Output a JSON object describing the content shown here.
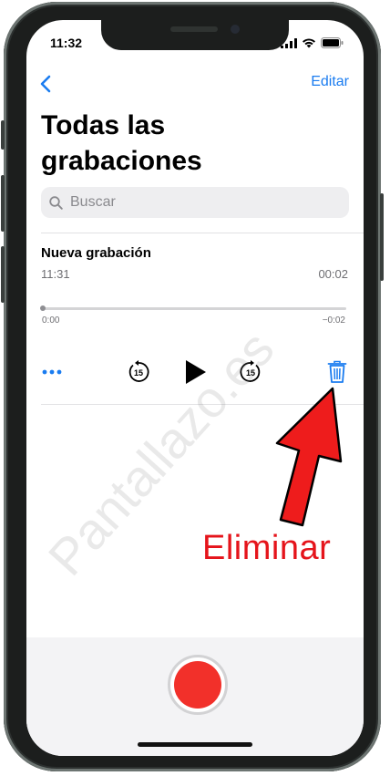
{
  "status_bar": {
    "time": "11:32",
    "icons": [
      "signal-icon",
      "wifi-icon",
      "battery-icon"
    ]
  },
  "nav": {
    "back_icon": "chevron-left-icon",
    "edit_label": "Editar"
  },
  "page": {
    "title": "Todas las grabaciones"
  },
  "search": {
    "icon": "search-icon",
    "placeholder": "Buscar"
  },
  "recording": {
    "title": "Nueva grabación",
    "time": "11:31",
    "duration": "00:02",
    "elapsed": "0:00",
    "remaining": "−0:02",
    "progress": 0
  },
  "controls": [
    "more-icon",
    "skip-back-15-icon",
    "play-icon",
    "skip-forward-15-icon",
    "trash-icon"
  ],
  "annotation": {
    "label": "Eliminar",
    "color": "#e5141b"
  },
  "watermark": "Pantallazo.es",
  "colors": {
    "accent": "#1a7cf0",
    "record": "#f2302a"
  }
}
